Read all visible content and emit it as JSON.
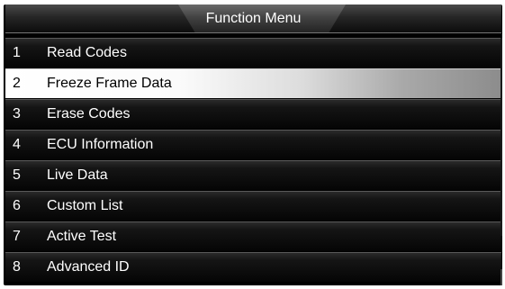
{
  "header": {
    "title": "Function Menu"
  },
  "menu": {
    "selected_index": 1,
    "items": [
      {
        "number": "1",
        "label": "Read Codes"
      },
      {
        "number": "2",
        "label": "Freeze Frame Data"
      },
      {
        "number": "3",
        "label": "Erase Codes"
      },
      {
        "number": "4",
        "label": "ECU Information"
      },
      {
        "number": "5",
        "label": "Live Data"
      },
      {
        "number": "6",
        "label": "Custom List"
      },
      {
        "number": "7",
        "label": "Active Test"
      },
      {
        "number": "8",
        "label": "Advanced ID"
      }
    ]
  },
  "colors": {
    "background": "#000000",
    "text": "#ffffff",
    "selected_text": "#000000",
    "selected_highlight": "#ffffff"
  }
}
